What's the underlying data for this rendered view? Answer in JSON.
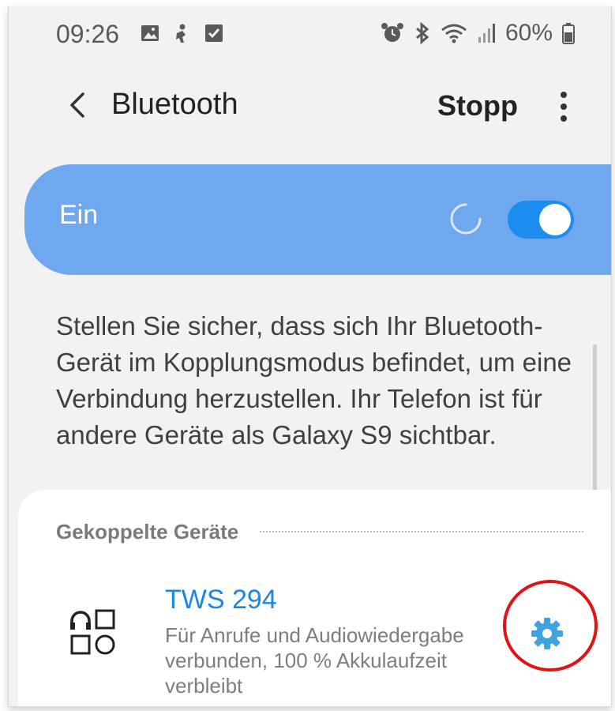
{
  "status_bar": {
    "time": "09:26",
    "battery": "60%",
    "icons_left": [
      "gallery-icon",
      "person-icon",
      "checkbox-icon"
    ],
    "icons_right": [
      "alarm-icon",
      "bluetooth-icon",
      "wifi-icon",
      "signal-icon",
      "battery-icon"
    ]
  },
  "app_bar": {
    "title": "Bluetooth",
    "stop_label": "Stopp"
  },
  "toggle_band": {
    "label": "Ein",
    "enabled": true,
    "scanning": true,
    "accent": "#6fa8ef",
    "switch_color": "#1b8cf0"
  },
  "description": "Stellen Sie sicher, dass sich Ihr Bluetooth-Gerät im Kopplungsmodus befindet, um eine Verbindung herzustellen. Ihr Telefon ist für andere Geräte als Galaxy S9 sichtbar.",
  "paired_section": {
    "header": "Gekoppelte Geräte",
    "devices": [
      {
        "name": "TWS 294",
        "status": "Für Anrufe und Audiowiedergabe verbunden, 100 % Akkulaufzeit verbleibt",
        "icon": "device-category-icon",
        "name_color": "#1d86e2"
      }
    ]
  },
  "annotation": {
    "highlight_color": "#e01414"
  }
}
